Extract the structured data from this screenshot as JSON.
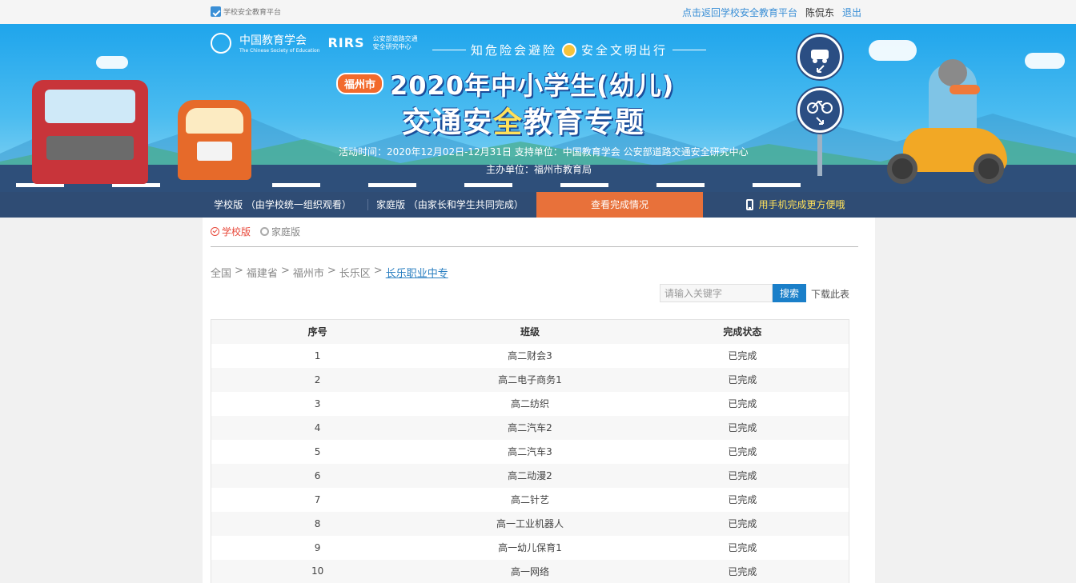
{
  "topbar": {
    "logo_text": "学校安全教育平台",
    "back_link": "点击返回学校安全教育平台",
    "user_name": "陈侃东",
    "logout": "退出"
  },
  "banner": {
    "org1_name": "中国教育学会",
    "org1_sub": "The Chinese Society of Education",
    "org2_abbr": "RIRS",
    "org2_name_line1": "公安部道路交通",
    "org2_name_line2": "安全研究中心",
    "slogan_left": "知危险会避险",
    "slogan_right": "安全文明出行",
    "city": "福州市",
    "title_line1": "2020年中小学生(幼儿)",
    "title_line2_part1": "交通安",
    "title_line2_part2": "全",
    "title_line2_part3": "教育专题",
    "info_line1": "活动时间：2020年12月02日-12月31日   支持单位：中国教育学会 公安部道路交通安全研究中心",
    "info_line2": "主办单位：福州市教育局"
  },
  "nav": {
    "school": "学校版 （由学校统一组织观看）",
    "family": "家庭版 （由家长和学生共同完成）",
    "status": "查看完成情况",
    "mobile": "用手机完成更方便哦"
  },
  "version_tabs": {
    "school": "学校版",
    "family": "家庭版"
  },
  "breadcrumb": {
    "items": [
      "全国",
      "福建省",
      "福州市",
      "长乐区"
    ],
    "separator": ">",
    "current": "长乐职业中专"
  },
  "search": {
    "placeholder": "请输入关键字",
    "button": "搜索",
    "download": "下载此表"
  },
  "table": {
    "headers": [
      "序号",
      "班级",
      "完成状态"
    ],
    "rows": [
      [
        "1",
        "高二财会3",
        "已完成"
      ],
      [
        "2",
        "高二电子商务1",
        "已完成"
      ],
      [
        "3",
        "高二纺织",
        "已完成"
      ],
      [
        "4",
        "高二汽车2",
        "已完成"
      ],
      [
        "5",
        "高二汽车3",
        "已完成"
      ],
      [
        "6",
        "高二动漫2",
        "已完成"
      ],
      [
        "7",
        "高二针艺",
        "已完成"
      ],
      [
        "8",
        "高一工业机器人",
        "已完成"
      ],
      [
        "9",
        "高一幼儿保育1",
        "已完成"
      ],
      [
        "10",
        "高一网络",
        "已完成"
      ]
    ]
  }
}
